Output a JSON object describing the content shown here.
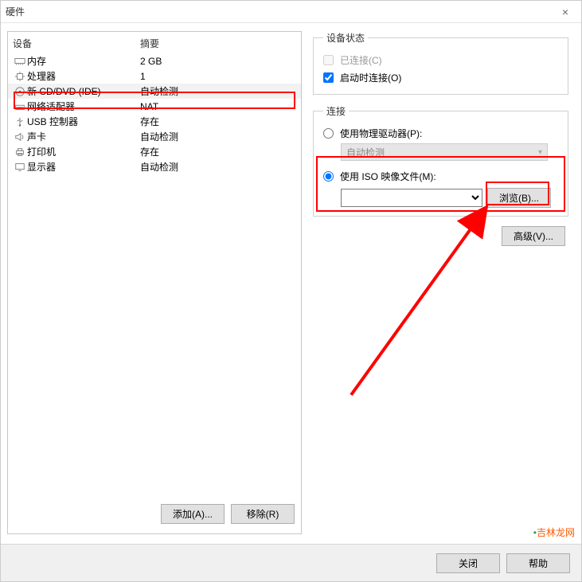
{
  "window": {
    "title": "硬件"
  },
  "columns": {
    "device": "设备",
    "summary": "摘要"
  },
  "devices": [
    {
      "icon": "memory",
      "name": "内存",
      "summary": "2 GB"
    },
    {
      "icon": "cpu",
      "name": "处理器",
      "summary": "1"
    },
    {
      "icon": "disc",
      "name": "新 CD/DVD (IDE)",
      "summary": "自动检测",
      "selected": true
    },
    {
      "icon": "network",
      "name": "网络适配器",
      "summary": "NAT"
    },
    {
      "icon": "usb",
      "name": "USB 控制器",
      "summary": "存在"
    },
    {
      "icon": "sound",
      "name": "声卡",
      "summary": "自动检测"
    },
    {
      "icon": "printer",
      "name": "打印机",
      "summary": "存在"
    },
    {
      "icon": "display",
      "name": "显示器",
      "summary": "自动检测"
    }
  ],
  "left_buttons": {
    "add": "添加(A)...",
    "remove": "移除(R)"
  },
  "status_group": {
    "legend": "设备状态",
    "connected": "已连接(C)",
    "connect_on_power": "启动时连接(O)"
  },
  "connection_group": {
    "legend": "连接",
    "use_physical": "使用物理驱动器(P):",
    "auto_detect": "自动检测",
    "use_iso": "使用 ISO 映像文件(M):",
    "browse": "浏览(B)..."
  },
  "advanced": "高级(V)...",
  "footer": {
    "close": "关闭",
    "help": "帮助"
  },
  "watermark": "吉林龙网"
}
